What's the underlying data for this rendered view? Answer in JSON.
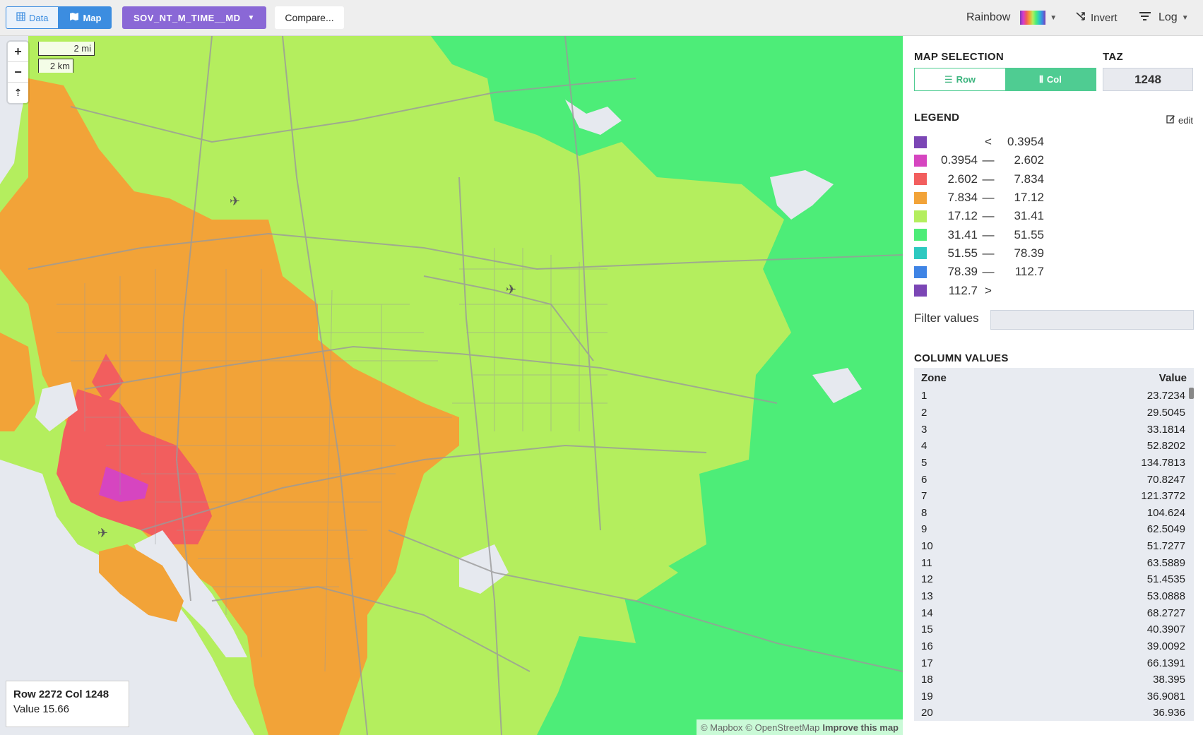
{
  "toolbar": {
    "data_label": "Data",
    "map_label": "Map",
    "matrix_name": "SOV_NT_M_TIME__MD",
    "compare_label": "Compare...",
    "colorscheme_label": "Rainbow",
    "invert_label": "Invert",
    "scale_label": "Log"
  },
  "map": {
    "scale_mi": "2 mi",
    "scale_km": "2 km",
    "info_title": "Row 2272 Col 1248",
    "info_value": "Value 15.66",
    "attribution_mapbox": "© Mapbox",
    "attribution_osm": "© OpenStreetMap",
    "attribution_improve": "Improve this map"
  },
  "panel": {
    "map_selection_title": "MAP SELECTION",
    "row_label": "Row",
    "col_label": "Col",
    "taz_title": "TAZ",
    "taz_value": "1248",
    "legend_title": "LEGEND",
    "edit_label": "edit",
    "legend": [
      {
        "color": "#7b46b5",
        "lo": "",
        "sep": "<",
        "hi": "0.3954"
      },
      {
        "color": "#d645c0",
        "lo": "0.3954",
        "sep": "—",
        "hi": "2.602"
      },
      {
        "color": "#f25e5e",
        "lo": "2.602",
        "sep": "—",
        "hi": "7.834"
      },
      {
        "color": "#f2a338",
        "lo": "7.834",
        "sep": "—",
        "hi": "17.12"
      },
      {
        "color": "#b4ee5e",
        "lo": "17.12",
        "sep": "—",
        "hi": "31.41"
      },
      {
        "color": "#4ded78",
        "lo": "31.41",
        "sep": "—",
        "hi": "51.55"
      },
      {
        "color": "#2dc9c0",
        "lo": "51.55",
        "sep": "—",
        "hi": "78.39"
      },
      {
        "color": "#3f84e5",
        "lo": "78.39",
        "sep": "—",
        "hi": "112.7"
      },
      {
        "color": "#7b46b5",
        "lo": "112.7",
        "sep": ">",
        "hi": ""
      }
    ],
    "filter_label": "Filter values",
    "filter_value": "",
    "column_values_title": "COLUMN VALUES",
    "col_header_zone": "Zone",
    "col_header_value": "Value",
    "rows": [
      [
        "1",
        "23.7234"
      ],
      [
        "2",
        "29.5045"
      ],
      [
        "3",
        "33.1814"
      ],
      [
        "4",
        "52.8202"
      ],
      [
        "5",
        "134.7813"
      ],
      [
        "6",
        "70.8247"
      ],
      [
        "7",
        "121.3772"
      ],
      [
        "8",
        "104.624"
      ],
      [
        "9",
        "62.5049"
      ],
      [
        "10",
        "51.7277"
      ],
      [
        "11",
        "63.5889"
      ],
      [
        "12",
        "51.4535"
      ],
      [
        "13",
        "53.0888"
      ],
      [
        "14",
        "68.2727"
      ],
      [
        "15",
        "40.3907"
      ],
      [
        "16",
        "39.0092"
      ],
      [
        "17",
        "66.1391"
      ],
      [
        "18",
        "38.395"
      ],
      [
        "19",
        "36.9081"
      ],
      [
        "20",
        "36.936"
      ]
    ]
  }
}
